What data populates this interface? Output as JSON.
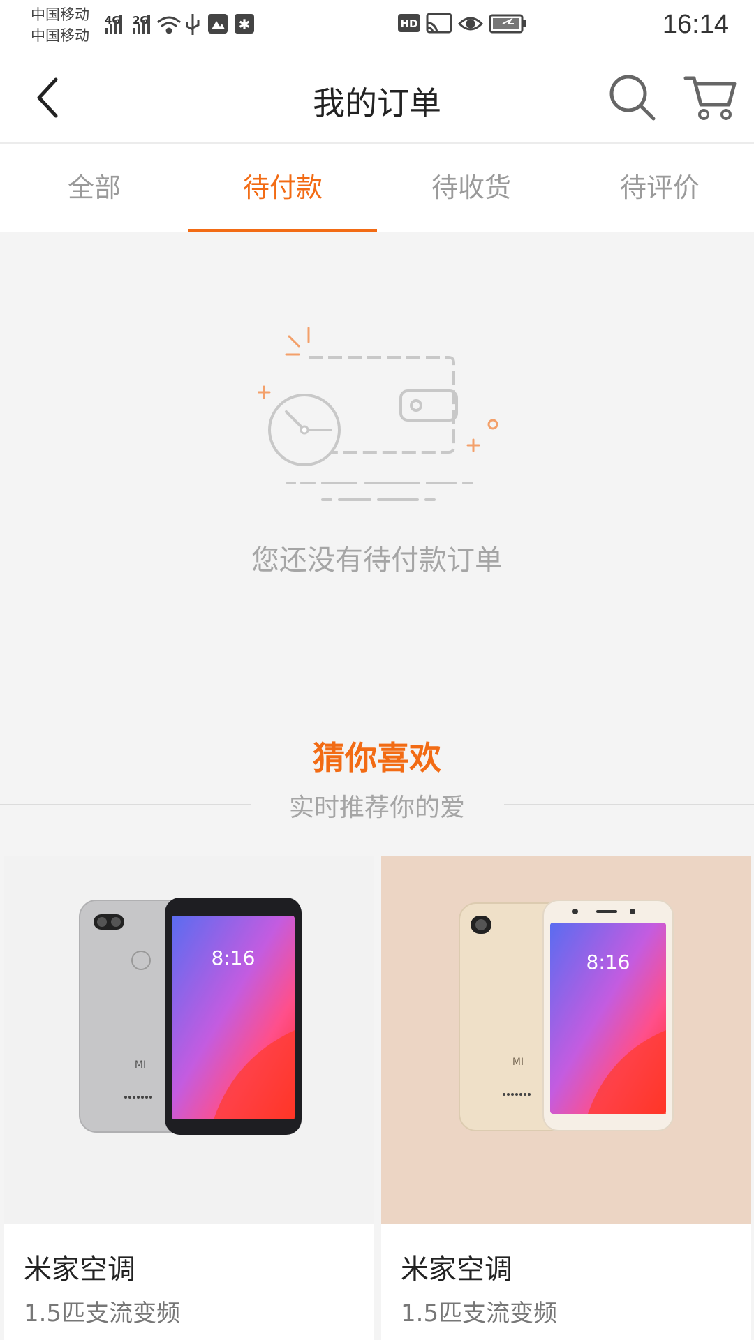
{
  "status_bar": {
    "carrier_1": "中国移动",
    "carrier_2": "中国移动",
    "network_1": "4G",
    "network_2": "2G",
    "hd_badge": "HD",
    "time": "16:14"
  },
  "header": {
    "title": "我的订单"
  },
  "tabs": [
    {
      "label": "全部",
      "active": false
    },
    {
      "label": "待付款",
      "active": true
    },
    {
      "label": "待收货",
      "active": false
    },
    {
      "label": "待评价",
      "active": false
    }
  ],
  "empty_state": {
    "message": "您还没有待付款订单"
  },
  "recommendations": {
    "title": "猜你喜欢",
    "subtitle": "实时推荐你的爱",
    "products": [
      {
        "name": "米家空调",
        "desc": "1.5匹支流变频",
        "phone_time": "8:16",
        "brand": "MI"
      },
      {
        "name": "米家空调",
        "desc": "1.5匹支流变频",
        "phone_time": "8:16",
        "brand": "MI"
      }
    ]
  },
  "colors": {
    "accent": "#f26b14",
    "muted_text": "#a5a5a5",
    "background": "#f4f4f4"
  }
}
